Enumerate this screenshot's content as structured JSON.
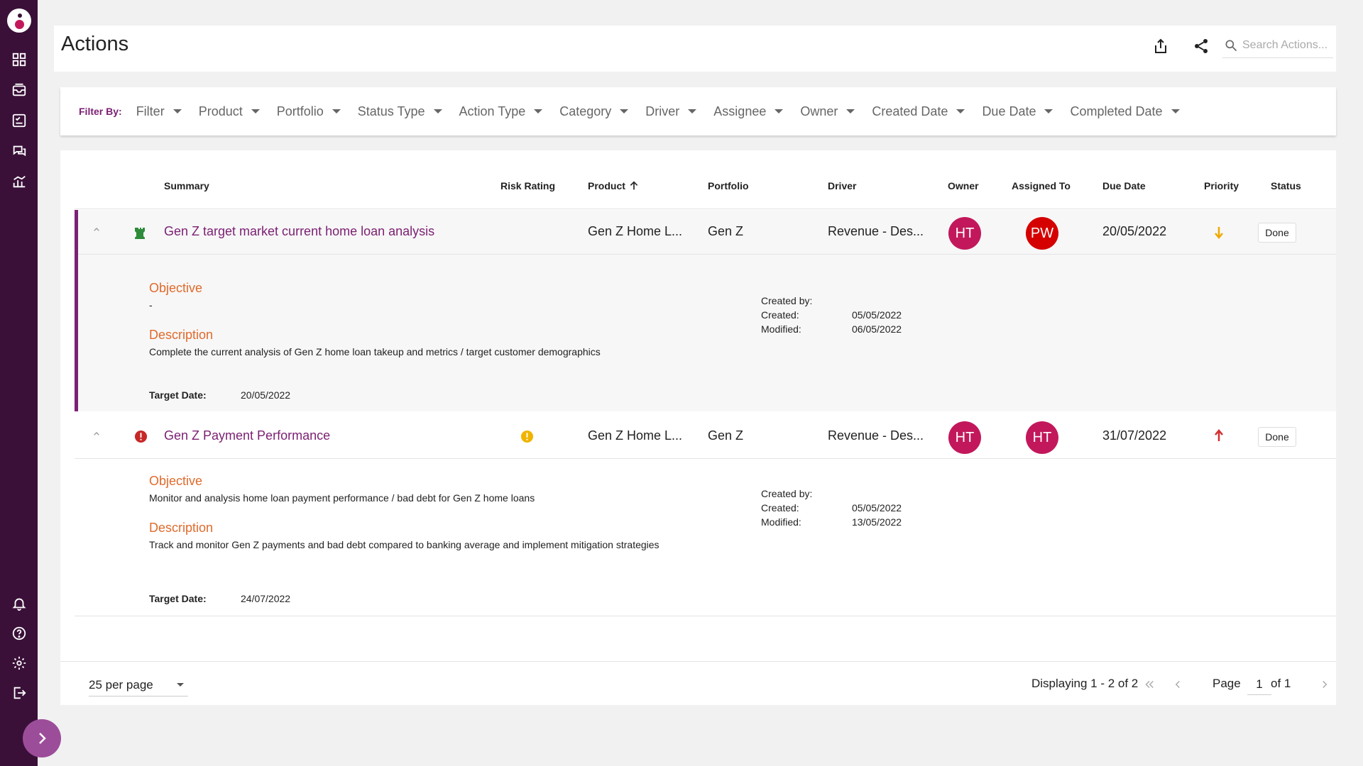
{
  "header": {
    "title": "Actions",
    "search_placeholder": "Search Actions..."
  },
  "nav": {
    "items": [
      "dashboard-icon",
      "inbox-icon",
      "task-icon",
      "chat-icon",
      "analytics-icon"
    ],
    "bottom_items": [
      "bell-icon",
      "help-icon",
      "settings-icon",
      "logout-icon"
    ]
  },
  "filters": {
    "label": "Filter By:",
    "items": [
      "Filter",
      "Product",
      "Portfolio",
      "Status Type",
      "Action Type",
      "Category",
      "Driver",
      "Assignee",
      "Owner",
      "Created Date",
      "Due Date",
      "Completed Date"
    ]
  },
  "table": {
    "columns": {
      "summary": "Summary",
      "risk_rating": "Risk Rating",
      "product": "Product",
      "portfolio": "Portfolio",
      "driver": "Driver",
      "owner": "Owner",
      "assigned_to": "Assigned To",
      "due_date": "Due Date",
      "priority": "Priority",
      "status": "Status"
    },
    "rows": [
      {
        "summary": "Gen Z target market current home loan analysis",
        "product": "Gen Z Home L...",
        "portfolio": "Gen Z",
        "driver": "Revenue - Des...",
        "owner": "HT",
        "assigned_to": "PW",
        "due_date": "20/05/2022",
        "status": "Done",
        "objective_label": "Objective",
        "objective": "-",
        "description_label": "Description",
        "description": "Complete the current analysis of Gen Z home loan takeup and metrics / target customer demographics",
        "target_date_label": "Target Date:",
        "target_date": "20/05/2022",
        "created_by_label": "Created by:",
        "created_label": "Created:",
        "created": "05/05/2022",
        "modified_label": "Modified:",
        "modified": "06/05/2022"
      },
      {
        "summary": "Gen Z Payment Performance",
        "product": "Gen Z Home L...",
        "portfolio": "Gen Z",
        "driver": "Revenue - Des...",
        "owner": "HT",
        "assigned_to": "HT",
        "due_date": "31/07/2022",
        "status": "Done",
        "objective_label": "Objective",
        "objective": "Monitor and analysis home loan payment performance / bad debt for Gen Z home loans",
        "description_label": "Description",
        "description": "Track and monitor Gen Z payments and bad debt compared to banking average and implement mitigation strategies",
        "target_date_label": "Target Date:",
        "target_date": "24/07/2022",
        "created_by_label": "Created by:",
        "created_label": "Created:",
        "created": "05/05/2022",
        "modified_label": "Modified:",
        "modified": "13/05/2022"
      }
    ]
  },
  "pagination": {
    "per_page": "25 per page",
    "displaying": "Displaying 1 - 2 of 2",
    "page_label": "Page",
    "page_value": "1",
    "of_label": "of 1"
  },
  "colors": {
    "rail": "#3a1038",
    "accent": "#7b1f72",
    "avatar_ht": "#c2185b",
    "avatar_pw": "#d50000",
    "objective_heading": "#e06a2c"
  }
}
